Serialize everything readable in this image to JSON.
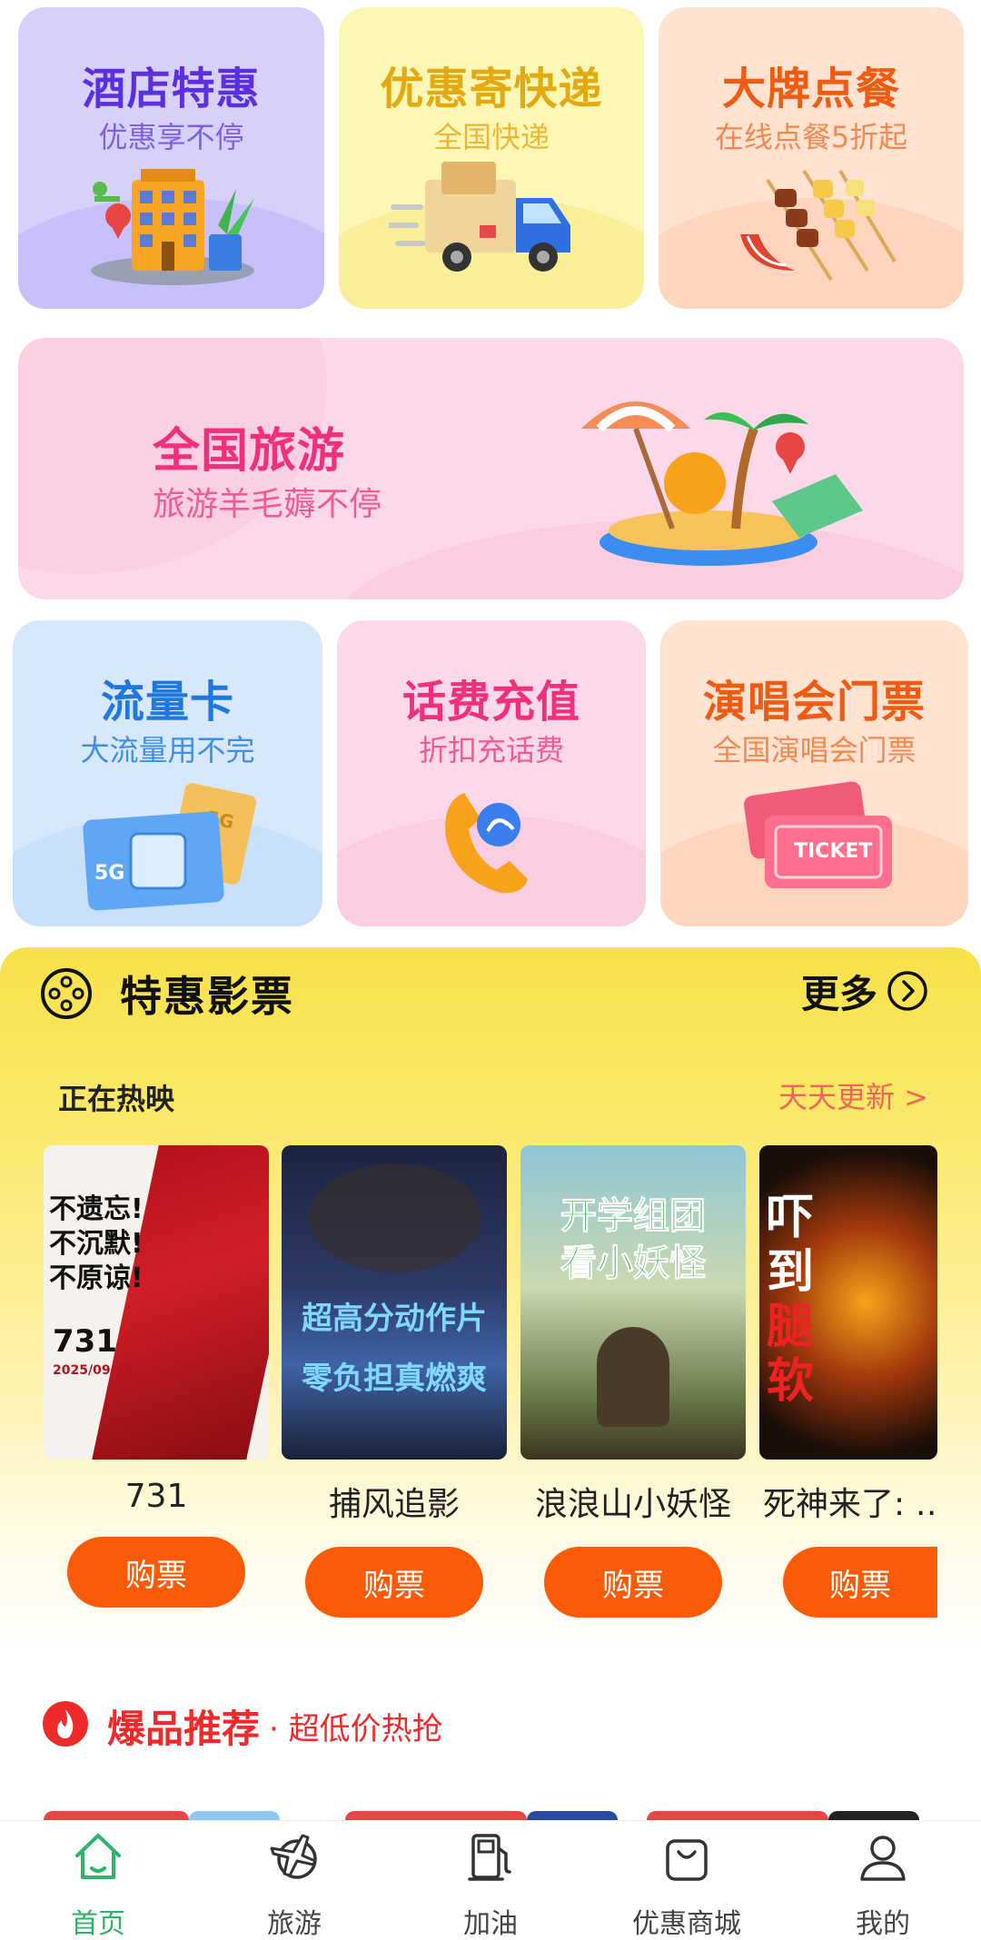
{
  "tiles": {
    "hotel": {
      "title": "酒店特惠",
      "subtitle": "优惠享不停"
    },
    "express": {
      "title": "优惠寄快递",
      "subtitle": "全国快递"
    },
    "food": {
      "title": "大牌点餐",
      "subtitle": "在线点餐5折起"
    },
    "travel": {
      "title": "全国旅游",
      "subtitle": "旅游羊毛薅不停"
    },
    "data_card": {
      "title": "流量卡",
      "subtitle": "大流量用不完"
    },
    "phone": {
      "title": "话费充值",
      "subtitle": "折扣充话费"
    },
    "concert": {
      "title": "演唱会门票",
      "subtitle": "全国演唱会门票"
    }
  },
  "movies": {
    "section_title": "特惠影票",
    "more_label": "更多",
    "now_showing": "正在热映",
    "daily_update": "天天更新 >",
    "buy_label": "购票",
    "items": [
      {
        "name": "731",
        "poster_lines": [
          "不遗忘!",
          "不沉默!",
          "不原谅!"
        ],
        "poster_extra": "731",
        "poster_date": "2025/09/18"
      },
      {
        "name": "捕风追影",
        "poster_lines": [
          "超高分动作片",
          "零负担真燃爽"
        ]
      },
      {
        "name": "浪浪山小妖怪",
        "poster_lines": [
          "开学组团",
          "看小妖怪"
        ]
      },
      {
        "name": "死神来了: …",
        "poster_lines": [
          "吓",
          "到",
          "腿",
          "软"
        ]
      }
    ]
  },
  "hot": {
    "title": "爆品推荐",
    "subtitle": "· 超低价热抢"
  },
  "nav": {
    "items": [
      {
        "label": "首页",
        "icon": "home-icon"
      },
      {
        "label": "旅游",
        "icon": "plane-globe-icon"
      },
      {
        "label": "加油",
        "icon": "fuel-pump-icon"
      },
      {
        "label": "优惠商城",
        "icon": "shopping-bag-icon"
      },
      {
        "label": "我的",
        "icon": "user-icon"
      }
    ]
  }
}
